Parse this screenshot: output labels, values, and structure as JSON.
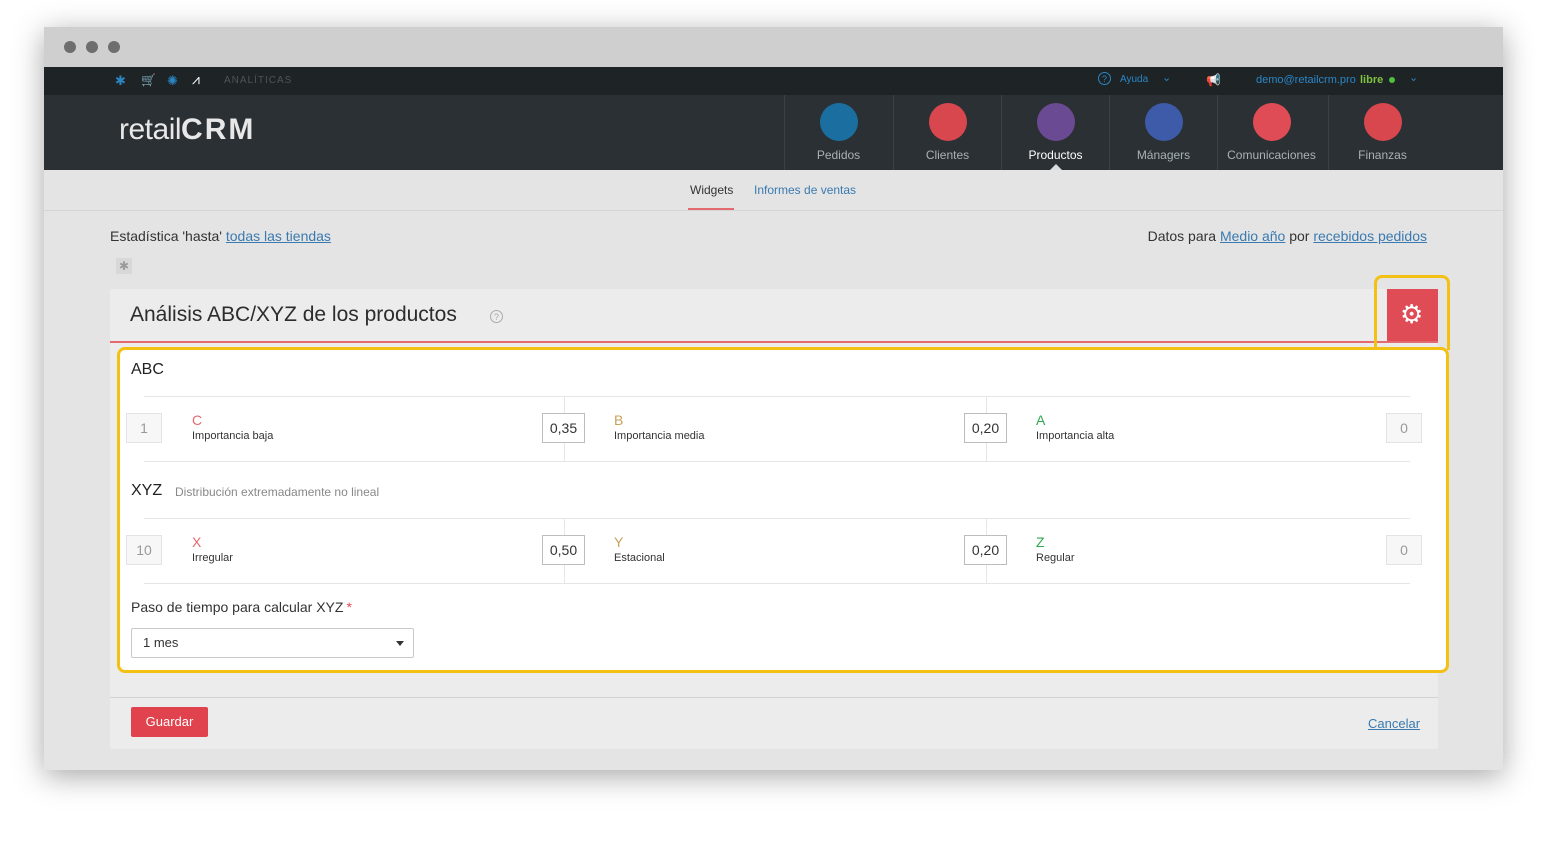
{
  "topbar": {
    "section_label": "ANALÍTICAS",
    "help_label": "Ayuda",
    "user_email": "demo@retailcrm.pro",
    "user_status": "libre"
  },
  "header": {
    "logo_text": "retail",
    "logo_bold": "CRM",
    "nav": [
      {
        "label": "Pedidos",
        "icon": "cart-icon",
        "color": "#1a6fa0"
      },
      {
        "label": "Clientes",
        "icon": "customer-icon",
        "color": "#d8464e"
      },
      {
        "label": "Productos",
        "icon": "box-icon",
        "color": "#6a4a93"
      },
      {
        "label": "Mánagers",
        "icon": "manager-icon",
        "color": "#3d5ba8"
      },
      {
        "label": "Comunicaciones",
        "icon": "chat-icon",
        "color": "#e04c55"
      },
      {
        "label": "Finanzas",
        "icon": "finance-icon",
        "color": "#d8464e"
      }
    ]
  },
  "subtabs": {
    "widgets": "Widgets",
    "sales_reports": "Informes de ventas"
  },
  "stats": {
    "left_prefix": "Estadística 'hasta'",
    "left_link": "todas las tiendas",
    "right_prefix": "Datos para",
    "right_link1": "Medio año",
    "right_mid": "por",
    "right_link2": "recebidos pedidos"
  },
  "panel": {
    "title": "Análisis ABC/XYZ de los productos",
    "abc": {
      "title": "ABC",
      "start": "1",
      "end": "0",
      "groups": [
        {
          "letter": "C",
          "label": "Importancia baja",
          "color": "#e36a6f",
          "value": "0,35"
        },
        {
          "letter": "B",
          "label": "Importancia media",
          "color": "#c9a25a",
          "value": "0,20"
        },
        {
          "letter": "A",
          "label": "Importancia alta",
          "color": "#2fa84f"
        }
      ]
    },
    "xyz": {
      "title": "XYZ",
      "subtitle": "Distribución extremadamente no lineal",
      "start": "10",
      "end": "0",
      "groups": [
        {
          "letter": "X",
          "label": "Irregular",
          "color": "#e36a6f",
          "value": "0,50"
        },
        {
          "letter": "Y",
          "label": "Estacional",
          "color": "#c9a25a",
          "value": "0,20"
        },
        {
          "letter": "Z",
          "label": "Regular",
          "color": "#2fa84f"
        }
      ]
    },
    "time_step": {
      "label": "Paso de tiempo para calcular XYZ",
      "required": "*",
      "selected": "1 mes"
    },
    "save": "Guardar",
    "cancel": "Cancelar"
  }
}
